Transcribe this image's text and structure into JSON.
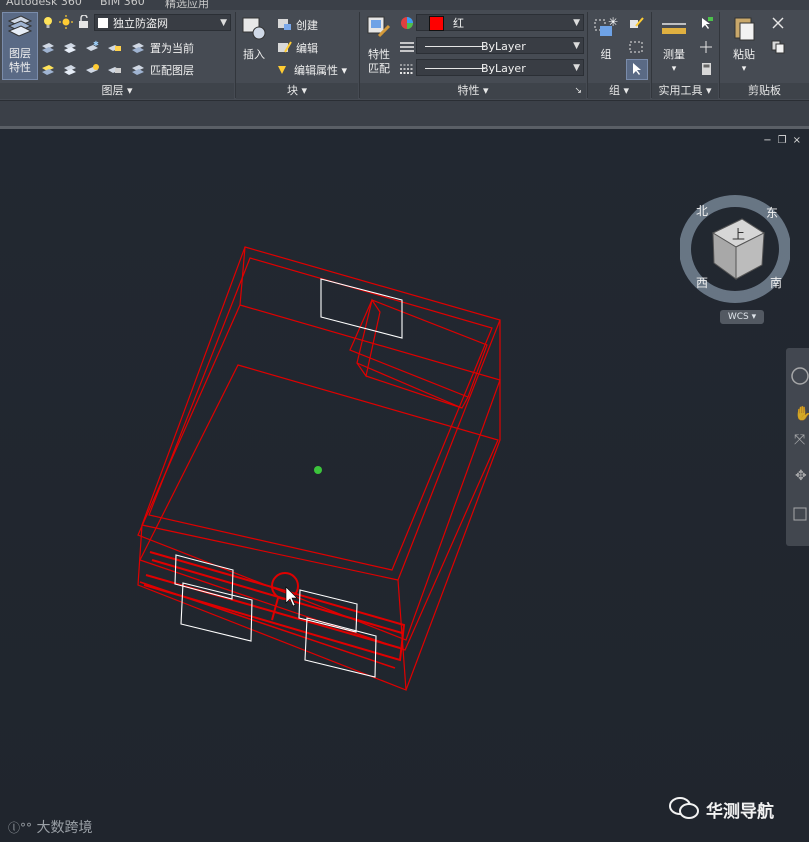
{
  "tabs": {
    "t1": "Autodesk 360",
    "t2": "BIM 360",
    "t3": "精选应用"
  },
  "layers_panel": {
    "big_button_line1": "图层",
    "big_button_line2": "特性",
    "layer_combo_value": "独立防盗网",
    "set_current_label": "置为当前",
    "match_layer_label": "匹配图层",
    "title": "图层"
  },
  "block_panel": {
    "insert_label": "插入",
    "create_label": "创建",
    "edit_label": "编辑",
    "edit_attr_label": "编辑属性",
    "title": "块"
  },
  "properties_panel": {
    "match_line1": "特性",
    "match_line2": "匹配",
    "color_value": "红",
    "color_hex": "#ff0000",
    "linetype_value": "ByLayer",
    "lineweight_value": "ByLayer",
    "title": "特性"
  },
  "groups_panel": {
    "group_label": "组",
    "title": "组"
  },
  "utilities_panel": {
    "measure_label": "测量",
    "title": "实用工具"
  },
  "clipboard_panel": {
    "paste_label": "粘贴",
    "title": "剪贴板"
  },
  "viewcube": {
    "top_face": "上",
    "north": "北",
    "east": "东",
    "south": "南",
    "west": "西"
  },
  "wcs_label": "WCS",
  "watermark_left": "大数跨境",
  "watermark_right": "华测导航",
  "colors": {
    "wire_red": "#e00000",
    "wire_white": "#ffffff",
    "ribbon_bg": "#464b53",
    "viewport_bg": "#222831",
    "pivot": "#3cc43c"
  }
}
